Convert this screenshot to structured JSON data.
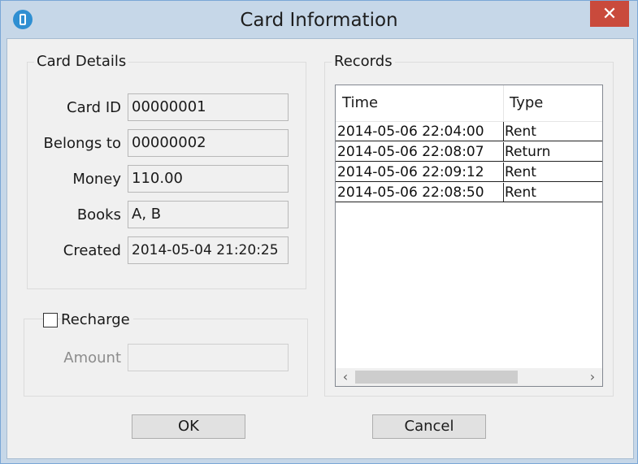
{
  "window": {
    "title": "Card Information",
    "close_glyph": "✕"
  },
  "card_details": {
    "legend": "Card Details",
    "fields": [
      {
        "label": "Card ID",
        "value": "00000001"
      },
      {
        "label": "Belongs to",
        "value": "00000002"
      },
      {
        "label": "Money",
        "value": "110.00"
      },
      {
        "label": "Books",
        "value": "A, B"
      },
      {
        "label": "Created",
        "value": "2014-05-04 21:20:25"
      }
    ]
  },
  "recharge": {
    "checkbox_label": "Recharge",
    "checked": false,
    "amount_label": "Amount",
    "amount_value": ""
  },
  "records": {
    "legend": "Records",
    "columns": [
      "Time",
      "Type"
    ],
    "rows": [
      {
        "time": "2014-05-06 22:04:00",
        "type": "Rent"
      },
      {
        "time": "2014-05-06 22:08:07",
        "type": "Return"
      },
      {
        "time": "2014-05-06 22:09:12",
        "type": "Rent"
      },
      {
        "time": "2014-05-06 22:08:50",
        "type": "Rent"
      }
    ],
    "scroll_left_glyph": "‹",
    "scroll_right_glyph": "›"
  },
  "buttons": {
    "ok": "OK",
    "cancel": "Cancel"
  },
  "icons": {
    "app": "card-app-icon",
    "close": "close-icon"
  },
  "colors": {
    "titlebar": "#c6d7e8",
    "close": "#c94a3c",
    "client": "#f0f0f0"
  }
}
